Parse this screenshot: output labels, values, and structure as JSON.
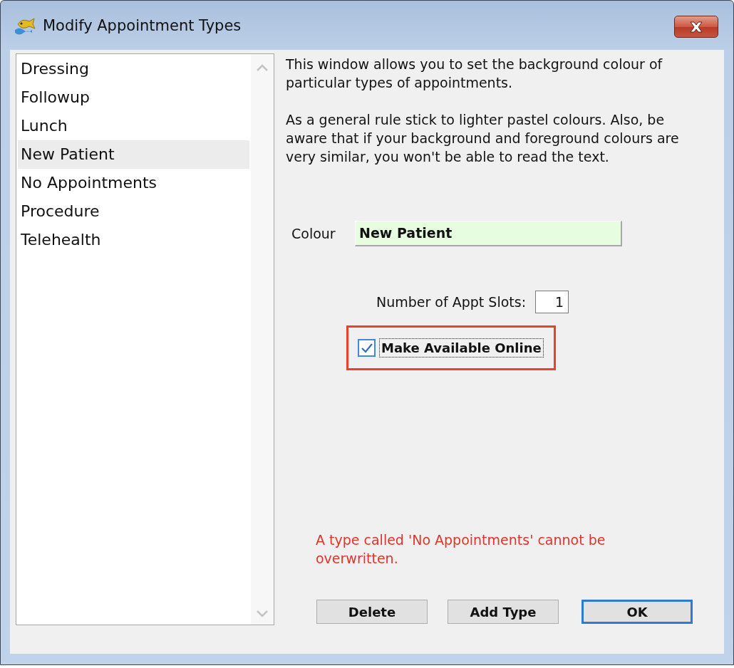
{
  "window": {
    "title": "Modify Appointment Types"
  },
  "types_list": {
    "items": [
      {
        "label": "Dressing",
        "selected": false
      },
      {
        "label": "Followup",
        "selected": false
      },
      {
        "label": "Lunch",
        "selected": false
      },
      {
        "label": "New Patient",
        "selected": true
      },
      {
        "label": "No Appointments",
        "selected": false
      },
      {
        "label": "Procedure",
        "selected": false
      },
      {
        "label": "Telehealth",
        "selected": false
      }
    ]
  },
  "description": [
    "This window allows you to set the background colour of particular types of appointments.",
    "As a general rule stick to lighter pastel colours. Also, be aware that if your background and foreground colours are very similar, you won't be able to read the text."
  ],
  "colour_field": {
    "label": "Colour",
    "value": "New Patient",
    "color": "#e6fde0"
  },
  "slots": {
    "label": "Number of Appt Slots:",
    "value": "1"
  },
  "online_checkbox": {
    "label": "Make Available Online",
    "checked": true,
    "focused": true,
    "annotated": true
  },
  "error_message": "A type called 'No Appointments' cannot be overwritten.",
  "buttons": [
    {
      "label": "Delete",
      "default": false
    },
    {
      "label": "Add Type",
      "default": false
    },
    {
      "label": "OK",
      "default": true
    }
  ]
}
